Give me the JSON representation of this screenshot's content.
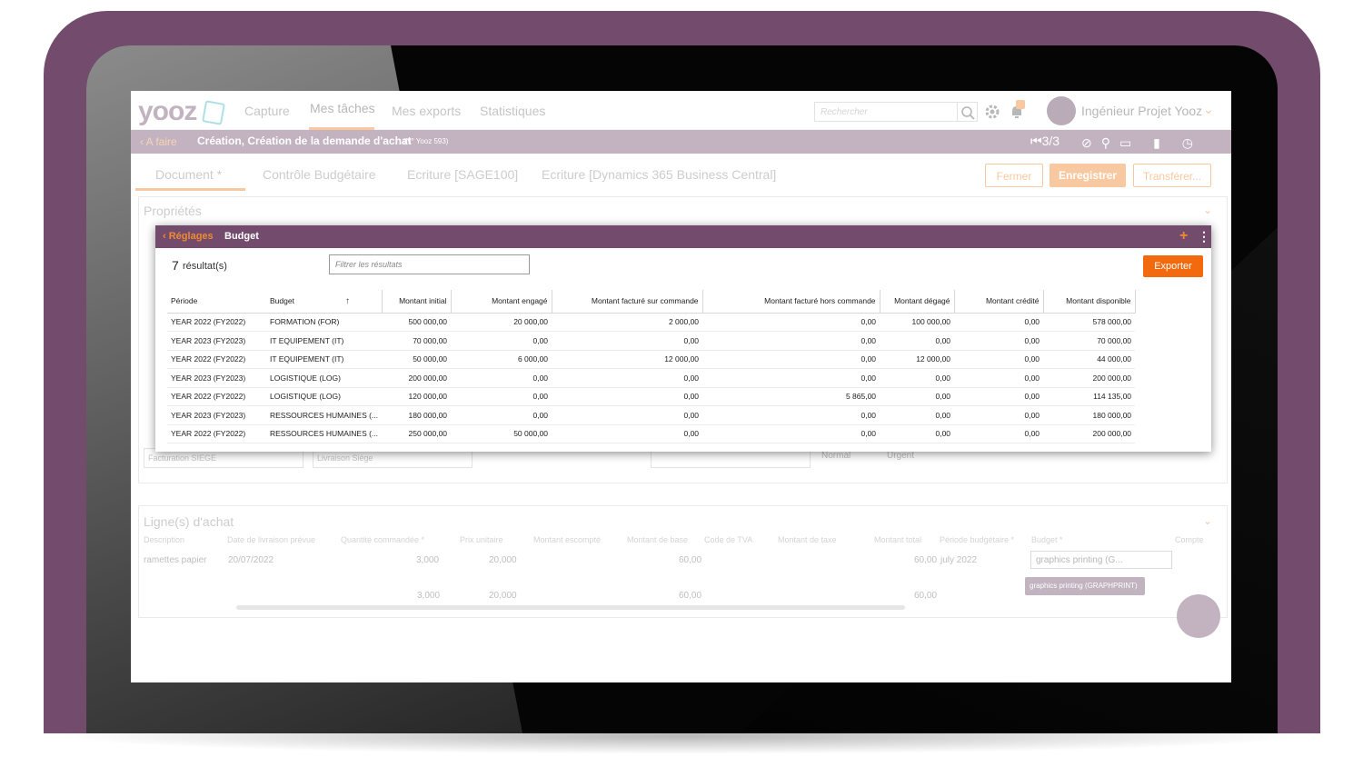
{
  "app": {
    "logo": "yooz",
    "nav": [
      "Capture",
      "Mes tâches",
      "Mes exports",
      "Statistiques"
    ],
    "search_placeholder": "Rechercher",
    "user_name": "Ingénieur Projet Yooz"
  },
  "subbar": {
    "back_label": "A faire",
    "title": "Création, Création de la demande d'achat",
    "reference": "(N° Yooz 593)",
    "pager": "3/3"
  },
  "tabs": [
    "Document *",
    "Contrôle Budgétaire",
    "Ecriture [SAGE100]",
    "Ecriture [Dynamics 365 Business Central]"
  ],
  "actions": {
    "close": "Fermer",
    "save": "Enregistrer",
    "transfer": "Transférer..."
  },
  "background": {
    "properties_title": "Propriétés",
    "lines_title": "Ligne(s) d'achat",
    "field_billing": "Facturation SIEGE",
    "field_delivery": "Livraison Siège",
    "radio_normal": "Normal",
    "radio_urgent": "Urgent",
    "lines_headers": [
      "Description",
      "Date de livraison prévue",
      "Quantité commandée *",
      "Prix unitaire",
      "Montant escompté",
      "Montant de base",
      "Code de TVA",
      "Montant de taxe",
      "Montant total",
      "Période budgétaire *",
      "Budget *",
      "Compte"
    ],
    "line_row": {
      "description": "ramettes papier",
      "date": "20/07/2022",
      "qty": "3,000",
      "price": "20,000",
      "base": "60,00",
      "total": "60,00",
      "period": "july 2022",
      "budget": "graphics printing (G..."
    },
    "totals_row": {
      "qty": "3,000",
      "price": "20,000",
      "base": "60,00",
      "total": "60,00"
    },
    "tooltip": "graphics printing (GRAPHPRINT)"
  },
  "modal": {
    "back_label": "Réglages",
    "title": "Budget",
    "result_count": "7",
    "result_label": "résultat(s)",
    "filter_placeholder": "Filtrer les résultats",
    "export_label": "Exporter",
    "columns": [
      "Période",
      "Budget",
      "Montant initial",
      "Montant engagé",
      "Montant facturé sur commande",
      "Montant facturé hors commande",
      "Montant dégagé",
      "Montant crédité",
      "Montant disponible"
    ],
    "rows": [
      [
        "YEAR 2022 (FY2022)",
        "FORMATION (FOR)",
        "500 000,00",
        "20 000,00",
        "2 000,00",
        "0,00",
        "100 000,00",
        "0,00",
        "578 000,00"
      ],
      [
        "YEAR 2023 (FY2023)",
        "IT EQUIPEMENT (IT)",
        "70 000,00",
        "0,00",
        "0,00",
        "0,00",
        "0,00",
        "0,00",
        "70 000,00"
      ],
      [
        "YEAR 2022 (FY2022)",
        "IT EQUIPEMENT (IT)",
        "50 000,00",
        "6 000,00",
        "12 000,00",
        "0,00",
        "12 000,00",
        "0,00",
        "44 000,00"
      ],
      [
        "YEAR 2023 (FY2023)",
        "LOGISTIQUE (LOG)",
        "200 000,00",
        "0,00",
        "0,00",
        "0,00",
        "0,00",
        "0,00",
        "200 000,00"
      ],
      [
        "YEAR 2022 (FY2022)",
        "LOGISTIQUE (LOG)",
        "120 000,00",
        "0,00",
        "0,00",
        "5 865,00",
        "0,00",
        "0,00",
        "114 135,00"
      ],
      [
        "YEAR 2023 (FY2023)",
        "RESSOURCES HUMAINES (...",
        "180 000,00",
        "0,00",
        "0,00",
        "0,00",
        "0,00",
        "0,00",
        "180 000,00"
      ],
      [
        "YEAR 2022 (FY2022)",
        "RESSOURCES HUMAINES (...",
        "250 000,00",
        "50 000,00",
        "0,00",
        "0,00",
        "0,00",
        "0,00",
        "200 000,00"
      ]
    ]
  },
  "colors": {
    "brand_purple": "#734c6d",
    "accent_orange": "#ef7d20"
  }
}
